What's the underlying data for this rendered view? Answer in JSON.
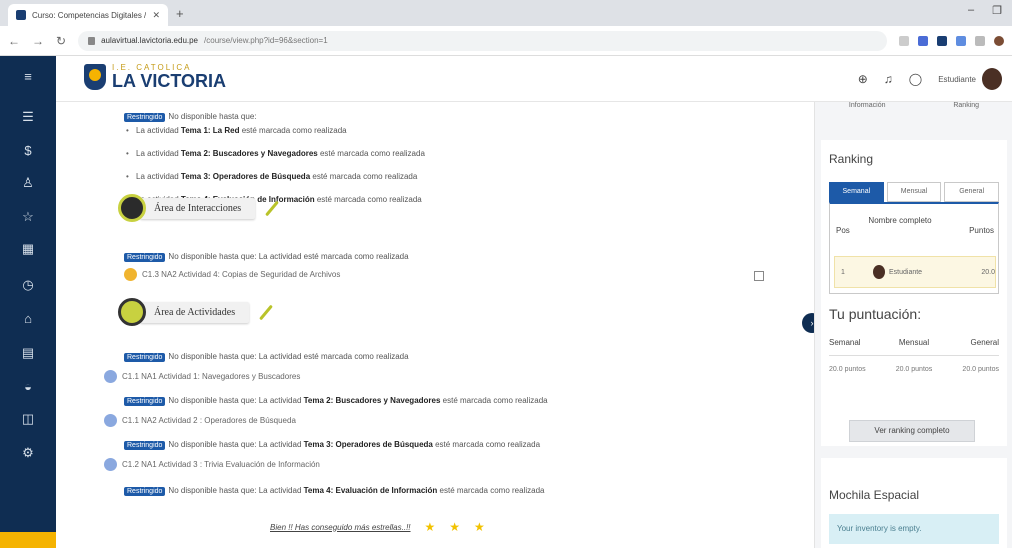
{
  "browser": {
    "tab_title": "Curso: Competencias Digitales / ",
    "tab_close": "✕",
    "new_tab": "+",
    "url_domain": "aulavirtual.lavictoria.edu.pe",
    "url_path": "/course/view.php?id=96&section=1",
    "window_controls": [
      "–",
      "❐"
    ]
  },
  "header": {
    "logo_small": "I.E. CATOLICA",
    "logo_big": "LA VICTORIA",
    "user_name": "Estudiante"
  },
  "main": {
    "restriction_badge": "Restringido",
    "block1_lead": "No disponible hasta que:",
    "block1_items": [
      {
        "pre": "La actividad ",
        "bold": "Tema 1: La Red",
        "post": " esté marcada como realizada"
      },
      {
        "pre": "La actividad ",
        "bold": "Tema 2: Buscadores y Navegadores",
        "post": " esté marcada como realizada"
      },
      {
        "pre": "La actividad ",
        "bold": "Tema 3: Operadores de Búsqueda",
        "post": " esté marcada como realizada"
      },
      {
        "pre": "La actividad ",
        "bold": "Tema 4: Evaluación de Información",
        "post": " esté marcada como realizada"
      }
    ],
    "section_interacciones": "Área de Interacciones",
    "restrict_done": "No disponible hasta que: La actividad esté marcada como realizada",
    "act_interacciones": "C1.3 NA2 Actividad 4: Copias de Seguridad de Archivos",
    "section_actividades": "Área de Actividades",
    "act1": "C1.1 NA1 Actividad 1: Navegadores y Buscadores",
    "restrict2_pre": "No disponible hasta que: La actividad ",
    "restrict2_bold": "Tema 2: Buscadores y Navegadores",
    "restrict2_post": " esté marcada como realizada",
    "act2": "C1.1 NA2 Actividad 2 : Operadores de Búsqueda",
    "restrict3_pre": "No disponible hasta que: La actividad ",
    "restrict3_bold": "Tema 3: Operadores de Búsqueda",
    "restrict3_post": " esté marcada como realizada",
    "act3": "C1.2 NA1 Actividad 3 : Trivia Evaluación de Información",
    "restrict4_pre": "No disponible hasta que: La actividad ",
    "restrict4_bold": "Tema 4: Evaluación de Información",
    "restrict4_post": " esté marcada como realizada",
    "stars_msg": "Bien !! Has conseguido más estrellas..!!",
    "star_glyph": "★"
  },
  "drawer": {
    "top_tabs": [
      "Información",
      "Ranking"
    ],
    "ranking_title": "Ranking",
    "ranking_tabs": [
      "Semanal",
      "Mensual",
      "General"
    ],
    "ranking_headers": [
      "Pos",
      "Nombre completo",
      "Puntos"
    ],
    "ranking_row": {
      "pos": "1",
      "name": "Estudiante",
      "points": "20.0"
    },
    "score_title": "Tu puntuación:",
    "score_headers": [
      "Semanal",
      "Mensual",
      "General"
    ],
    "score_values": [
      "20.0 puntos",
      "20.0 puntos",
      "20.0 puntos"
    ],
    "full_ranking_btn": "Ver ranking completo",
    "mochila_title": "Mochila Espacial",
    "inventory_msg": "Your inventory is empty."
  },
  "colors": {
    "nav_bg": "#0f2d52",
    "accent_blue": "#1d5aa8",
    "accent_yellow": "#f5b301",
    "section_green": "#c8d140"
  }
}
